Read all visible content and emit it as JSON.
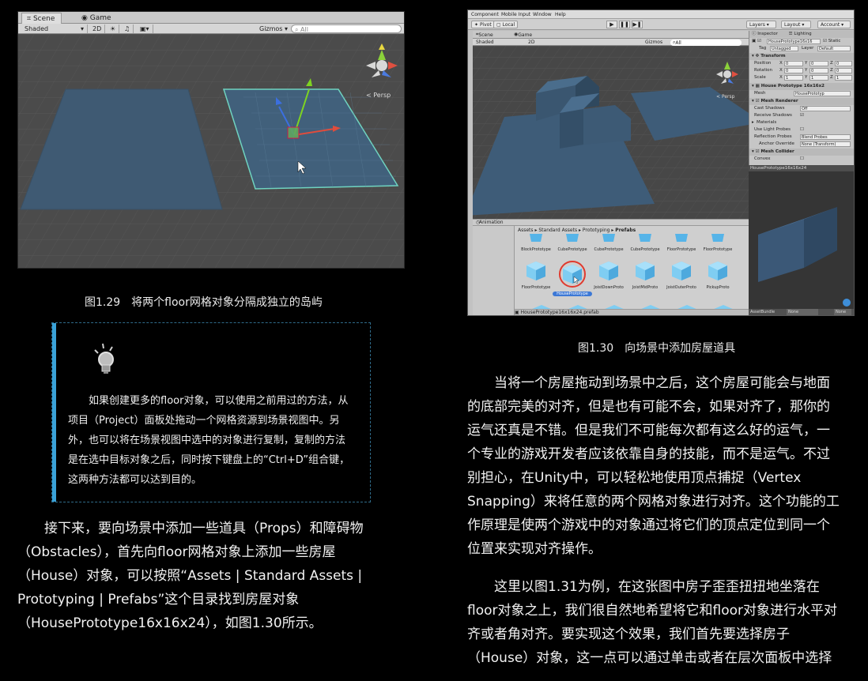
{
  "fig129": {
    "tabs": [
      "Scene",
      "Game"
    ],
    "toolbar": {
      "shading": "Shaded",
      "mode_2d": "2D",
      "gizmos": "Gizmos",
      "search_placeholder": "All"
    },
    "persp_label": "Persp",
    "caption": "图1.29　将两个floor网格对象分隔成独立的岛屿"
  },
  "tip": {
    "icon": "lightbulb-icon",
    "text": "如果创建更多的floor对象，可以使用之前用过的方法，从项目（Project）面板处拖动一个网格资源到场景视图中。另外，也可以将在场景视图中选中的对象进行复制，复制的方法是在选中目标对象之后，同时按下键盘上的“Ctrl+D”组合键，这两种方法都可以达到目的。"
  },
  "left_paragraph": {
    "lines": [
      "　　接下来，要向场景中添加一些道具（Props）和障碍物",
      "（Obstacles），首先向floor网格对象上添加一些房屋",
      "（House）对象，可以按照“Assets | Standard Assets |",
      "Prototyping | Prefabs”这个目录找到房屋对象",
      "（HousePrototype16x16x24），如图1.30所示。"
    ]
  },
  "fig130": {
    "menu": [
      "Component",
      "Mobile Input",
      "Window",
      "Help"
    ],
    "toolbar": {
      "pivot": "Pivot",
      "local": "Local",
      "layers": "Layers",
      "layout": "Layout",
      "account": "Account"
    },
    "scene_tabs": [
      "Scene",
      "Game"
    ],
    "scene_toolbar": {
      "shading": "Shaded",
      "mode_2d": "2D",
      "gizmos": "Gizmos",
      "search": "All"
    },
    "persp_label": "Persp",
    "animation_tab": "Animation",
    "breadcrumb": [
      "Assets",
      "Standard Assets",
      "Prototyping",
      "Prefabs"
    ],
    "assets_row1": [
      "BlockPrototype",
      "CubePrototype",
      "CubePrototype",
      "CubePrototype",
      "FloorPrototype",
      "FloorPrototype"
    ],
    "assets_row2": [
      "FloorPrototype",
      "HousePrototype",
      "JoistDownProto",
      "JoistMidProto",
      "JoistOuterProto",
      "PickupProto"
    ],
    "selected_asset": "HousePrototype",
    "path_bar": "HousePrototype16x16x24.prefab",
    "inspector": {
      "tabs": [
        "Inspector",
        "Lighting"
      ],
      "object_name": "HousePrototype16x16",
      "static_label": "Static",
      "tag_label": "Tag",
      "tag_value": "Untagged",
      "layer_label": "Layer",
      "layer_value": "Default",
      "transform": "Transform",
      "position": "Position",
      "rotation": "Rotation",
      "scale": "Scale",
      "pos_values": [
        "0",
        "0",
        "0"
      ],
      "rot_values": [
        "0",
        "0",
        "0"
      ],
      "scale_values": [
        "1",
        "1",
        "1"
      ],
      "mesh_filter": "House Prototype 16x16x2",
      "mesh_label": "Mesh",
      "mesh_value": "HousePrototyp",
      "mesh_renderer": "Mesh Renderer",
      "cast_shadows": "Cast Shadows",
      "cast_shadows_value": "Off",
      "receive_shadows": "Receive Shadows",
      "materials": "Materials",
      "use_light_probes": "Use Light Probes",
      "reflection_probes": "Reflection Probes",
      "reflection_value": "Blend Probes",
      "anchor_override": "Anchor Override",
      "anchor_value": "None (Transform)",
      "mesh_collider": "Mesh Collider",
      "convex": "Convex",
      "preview_title": "HousePrototype16x16x24",
      "asset_bundle": "AssetBundle",
      "bundle_value": "None",
      "bundle_value2": "None"
    },
    "caption": "图1.30　向场景中添加房屋道具"
  },
  "right_paragraph1": {
    "lines": [
      "　　当将一个房屋拖动到场景中之后，这个房屋可能会与地面",
      "的底部完美的对齐，但是也有可能不会，如果对齐了，那你的",
      "运气还真是不错。但是我们不可能每次都有这么好的运气，一",
      "个专业的游戏开发者应该依靠自身的技能，而不是运气。不过",
      "别担心，在Unity中，可以轻松地使用顶点捕捉（Vertex",
      "Snapping）来将任意的两个网格对象进行对齐。这个功能的工",
      "作原理是使两个游戏中的对象通过将它们的顶点定位到同一个",
      "位置来实现对齐操作。"
    ]
  },
  "right_paragraph2": {
    "lines": [
      "　　这里以图1.31为例，在这张图中房子歪歪扭扭地坐落在",
      "floor对象之上，我们很自然地希望将它和floor对象进行水平对",
      "齐或者角对齐。要实现这个效果，我们首先要选择房子",
      "（House）对象，这一点可以通过单击或者在层次面板中选择"
    ]
  }
}
